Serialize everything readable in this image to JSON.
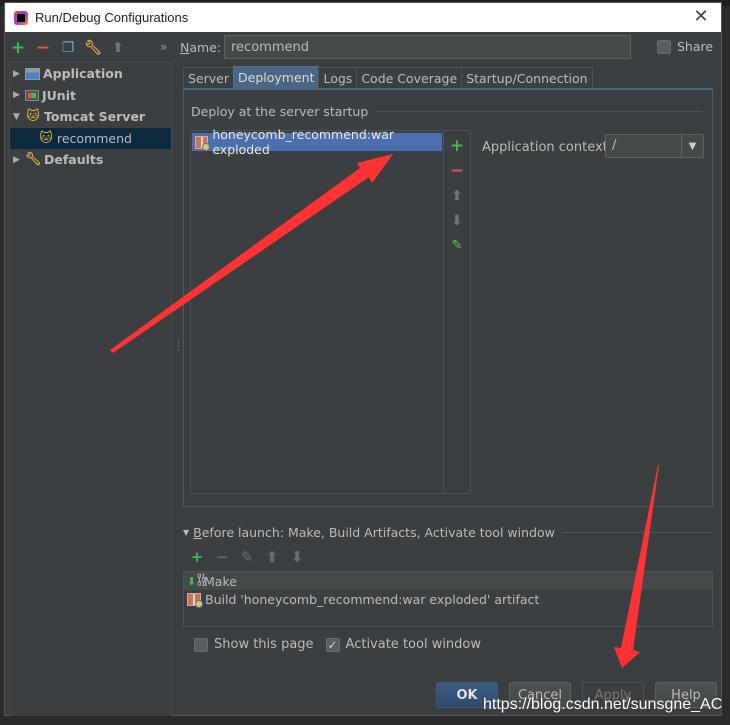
{
  "window": {
    "title": "Run/Debug Configurations",
    "close_icon": "close-icon"
  },
  "left_toolbar": {
    "icons": [
      "add-icon",
      "remove-icon",
      "copy-icon",
      "wrench-icon",
      "move-up-icon"
    ],
    "more": "»"
  },
  "tree": {
    "items": [
      {
        "label": "Application",
        "expanded": false
      },
      {
        "label": "JUnit",
        "expanded": false
      },
      {
        "label": "Tomcat Server",
        "expanded": true
      },
      {
        "label": "recommend",
        "selected": true,
        "child": true
      },
      {
        "label": "Defaults",
        "expanded": false
      }
    ]
  },
  "name_field": {
    "label_prefix": "N",
    "label_rest": "ame:",
    "value": "recommend"
  },
  "share": {
    "label": "Share",
    "checked": false
  },
  "tabs": [
    {
      "label": "Server"
    },
    {
      "label": "Deployment",
      "active": true
    },
    {
      "label": "Logs"
    },
    {
      "label": "Code Coverage"
    },
    {
      "label": "Startup/Connection"
    }
  ],
  "deployment": {
    "section_title": "Deploy at the server startup",
    "artifacts": [
      "honeycomb_recommend:war exploded"
    ],
    "side_tools": [
      "add-icon",
      "remove-icon",
      "arrow-up-icon",
      "arrow-down-icon",
      "edit-icon"
    ],
    "app_context_label": "Application context:",
    "app_context_value": "/"
  },
  "before_launch": {
    "header_prefix": "B",
    "header_rest": "efore launch: Make, Build Artifacts, Activate tool window",
    "tasks": [
      "Make",
      "Build 'honeycomb_recommend:war exploded' artifact"
    ]
  },
  "options": {
    "show_this_page": {
      "label": "Show this page",
      "checked": false
    },
    "activate_tool_window": {
      "label": "Activate tool window",
      "checked": true
    }
  },
  "buttons": {
    "ok": "OK",
    "cancel": "Cancel",
    "apply": "Apply",
    "help": "Help"
  },
  "watermark": "https://blog.csdn.net/sunsgne_AC",
  "annotation_color": "#ff3333"
}
